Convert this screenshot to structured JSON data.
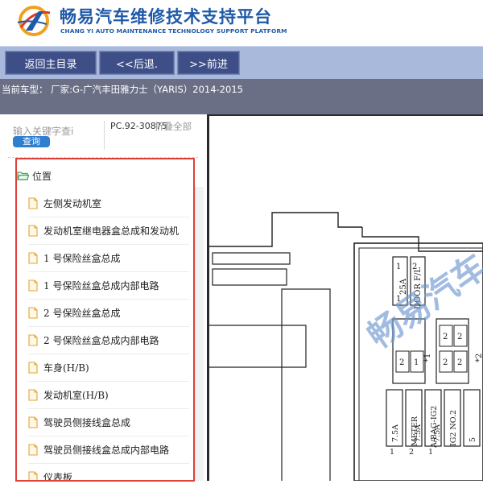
{
  "header": {
    "title_cn": "畅易汽车维修技术支持平台",
    "title_en": "CHANG YI AUTO MAINTENANCE TECHNOLOGY SUPPORT PLATFORM",
    "brand_color": "#1f5aa8"
  },
  "toolbar": {
    "buttons": [
      {
        "label": "返回主目录"
      },
      {
        "label": "<<后退."
      },
      {
        "label": ">>前进"
      }
    ]
  },
  "vehicle": {
    "text": "当前车型：  厂家:G-广汽丰田雅力士（YARIS）2014-2015"
  },
  "sidebar": {
    "search_placeholder": "输入关键字查i",
    "query_label": "查询",
    "model_code": "PC.92-30875",
    "collapse_label": "折叠全部",
    "root_label": "位置",
    "items": [
      {
        "label": "左侧发动机室"
      },
      {
        "label": "发动机室继电器盒总成和发动机"
      },
      {
        "label": "1 号保险丝盒总成"
      },
      {
        "label": "1 号保险丝盒总成内部电路"
      },
      {
        "label": "2 号保险丝盒总成"
      },
      {
        "label": "2 号保险丝盒总成内部电路"
      },
      {
        "label": "车身(H/B)"
      },
      {
        "label": "发动机室(H/B)"
      },
      {
        "label": "驾驶员侧接线盒总成"
      },
      {
        "label": "驾驶员侧接线盒总成内部电路"
      },
      {
        "label": "仪表板"
      }
    ]
  },
  "diagram": {
    "watermark": "畅易汽车",
    "fuse_labels": [
      "25A",
      "DOOR F/L",
      "7.5A",
      "METER",
      "7.5A",
      "A/BAG-IG2",
      "7.5A",
      "IG2 NO.2",
      "5"
    ],
    "fuse_numbers": [
      "1",
      "2",
      "1",
      "2",
      "1",
      "2",
      "2",
      "2",
      "2",
      "1",
      "2",
      "1"
    ],
    "marks": [
      "*1",
      "*2"
    ]
  },
  "colors": {
    "toolbar_bg": "#a9b9dc",
    "button_bg": "#3e4f88",
    "vehicle_bar": "#6b6f86",
    "highlight_border": "#e0403a",
    "query_button": "#2f7fd0"
  }
}
